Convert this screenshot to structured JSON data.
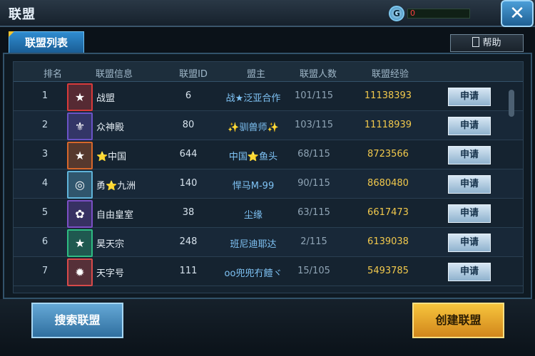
{
  "header": {
    "title": "联盟",
    "currency_value": "0",
    "close_label": "✕",
    "coin_label": "G"
  },
  "tabs": [
    {
      "label": "联盟列表"
    }
  ],
  "help_label": "帮助",
  "table": {
    "columns": [
      "排名",
      "联盟信息",
      "联盟ID",
      "盟主",
      "联盟人数",
      "联盟经验"
    ],
    "rows": [
      {
        "rank": "1",
        "name": "战盟",
        "id": "6",
        "leader": "战★泛亚合作",
        "members": "101/115",
        "exp": "11138393",
        "emblem_color": "#d83a3a",
        "apply": "申请"
      },
      {
        "rank": "2",
        "name": "众神殿",
        "id": "80",
        "leader": "✨驯兽师✨",
        "members": "103/115",
        "exp": "11118939",
        "emblem_color": "#6a53c7",
        "apply": "申请"
      },
      {
        "rank": "3",
        "name": "⭐中国",
        "id": "644",
        "leader": "中国⭐鱼头",
        "members": "68/115",
        "exp": "8723566",
        "emblem_color": "#d7672b",
        "apply": "申请"
      },
      {
        "rank": "4",
        "name": "勇⭐九洲",
        "id": "140",
        "leader": "悍马M-99",
        "members": "90/115",
        "exp": "8680480",
        "emblem_color": "#5fb3d9",
        "apply": "申请"
      },
      {
        "rank": "5",
        "name": "自由皇室",
        "id": "38",
        "leader": "尘缘",
        "members": "63/115",
        "exp": "6617473",
        "emblem_color": "#7b4fc5",
        "apply": "申请"
      },
      {
        "rank": "6",
        "name": "昊天宗",
        "id": "248",
        "leader": "班尼迪耶达",
        "members": "2/115",
        "exp": "6139038",
        "emblem_color": "#2ebc82",
        "apply": "申请"
      },
      {
        "rank": "7",
        "name": "天字号",
        "id": "111",
        "leader": "oo兜兜冇饐ヾ",
        "members": "15/105",
        "exp": "5493785",
        "emblem_color": "#d84a4a",
        "apply": "申请"
      }
    ]
  },
  "footer": {
    "search_label": "搜索联盟",
    "create_label": "创建联盟"
  }
}
